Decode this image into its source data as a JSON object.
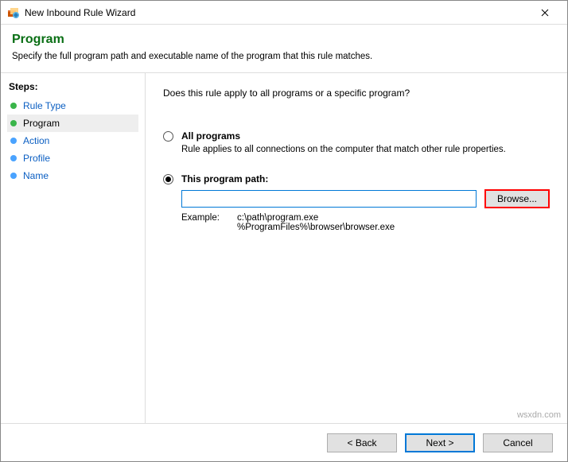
{
  "window": {
    "title": "New Inbound Rule Wizard"
  },
  "header": {
    "title": "Program",
    "subtitle": "Specify the full program path and executable name of the program that this rule matches."
  },
  "sidebar": {
    "title": "Steps:",
    "items": [
      {
        "label": "Rule Type"
      },
      {
        "label": "Program"
      },
      {
        "label": "Action"
      },
      {
        "label": "Profile"
      },
      {
        "label": "Name"
      }
    ]
  },
  "main": {
    "question": "Does this rule apply to all programs or a specific program?",
    "option_all": {
      "label": "All programs",
      "desc": "Rule applies to all connections on the computer that match other rule properties."
    },
    "option_path": {
      "label": "This program path:",
      "input_value": "",
      "browse_label": "Browse...",
      "example_label": "Example:",
      "example_1": "c:\\path\\program.exe",
      "example_2": "%ProgramFiles%\\browser\\browser.exe"
    }
  },
  "footer": {
    "back": "< Back",
    "next": "Next >",
    "cancel": "Cancel"
  },
  "watermark": "wsxdn.com"
}
